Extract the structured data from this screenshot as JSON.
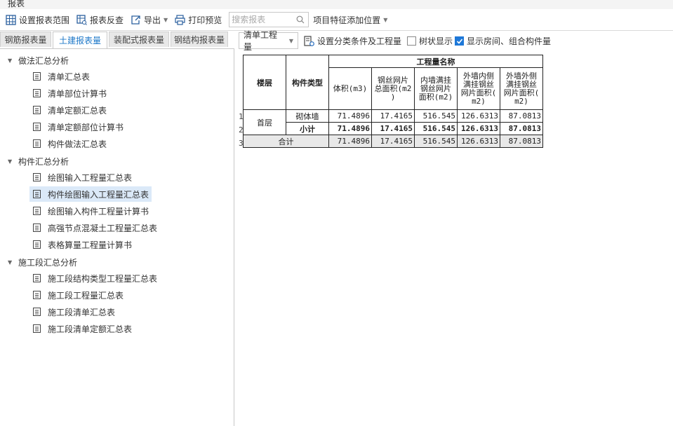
{
  "window": {
    "title": "报表"
  },
  "toolbar": {
    "set_range": "设置报表范围",
    "reverse_check": "报表反查",
    "export": "导出",
    "print_preview": "打印预览",
    "search_placeholder": "搜索报表",
    "add_position": "项目特征添加位置"
  },
  "left_tabs": [
    "钢筋报表量",
    "土建报表量",
    "装配式报表量",
    "钢结构报表量"
  ],
  "tree": {
    "groups": [
      {
        "label": "做法汇总分析",
        "items": [
          "清单汇总表",
          "清单部位计算书",
          "清单定额汇总表",
          "清单定额部位计算书",
          "构件做法汇总表"
        ]
      },
      {
        "label": "构件汇总分析",
        "items": [
          "绘图输入工程量汇总表",
          "构件绘图输入工程量汇总表",
          "绘图输入构件工程量计算书",
          "高强节点混凝土工程量汇总表",
          "表格算量工程量计算书"
        ]
      },
      {
        "label": "施工段汇总分析",
        "items": [
          "施工段结构类型工程量汇总表",
          "施工段工程量汇总表",
          "施工段清单汇总表",
          "施工段清单定额汇总表"
        ]
      }
    ]
  },
  "right_toolbar": {
    "dropdown_value": "清单工程量",
    "set_conditions": "设置分类条件及工程量",
    "tree_display": "树状显示",
    "show_rooms": "显示房间、组合构件量"
  },
  "table": {
    "header_group": "工程量名称",
    "floor": "楼层",
    "component_type": "构件类型",
    "columns": [
      "体积(m3)",
      "钢丝网片\n总面积(m2\n)",
      "内墙满挂\n钢丝网片\n面积(m2)",
      "外墙内侧\n满挂钢丝\n网片面积(\nm2)",
      "外墙外侧\n满挂钢丝\n网片面积(\nm2)"
    ],
    "row_numbers": [
      "1",
      "2",
      "3"
    ],
    "rows": [
      {
        "floor": "首层",
        "type": "砌体墙",
        "values": [
          "71.4896",
          "17.4165",
          "516.545",
          "126.6313",
          "87.0813"
        ]
      },
      {
        "floor": "",
        "type": "小计",
        "values": [
          "71.4896",
          "17.4165",
          "516.545",
          "126.6313",
          "87.0813"
        ]
      }
    ],
    "total": {
      "label": "合计",
      "values": [
        "71.4896",
        "17.4165",
        "516.545",
        "126.6313",
        "87.0813"
      ]
    }
  }
}
